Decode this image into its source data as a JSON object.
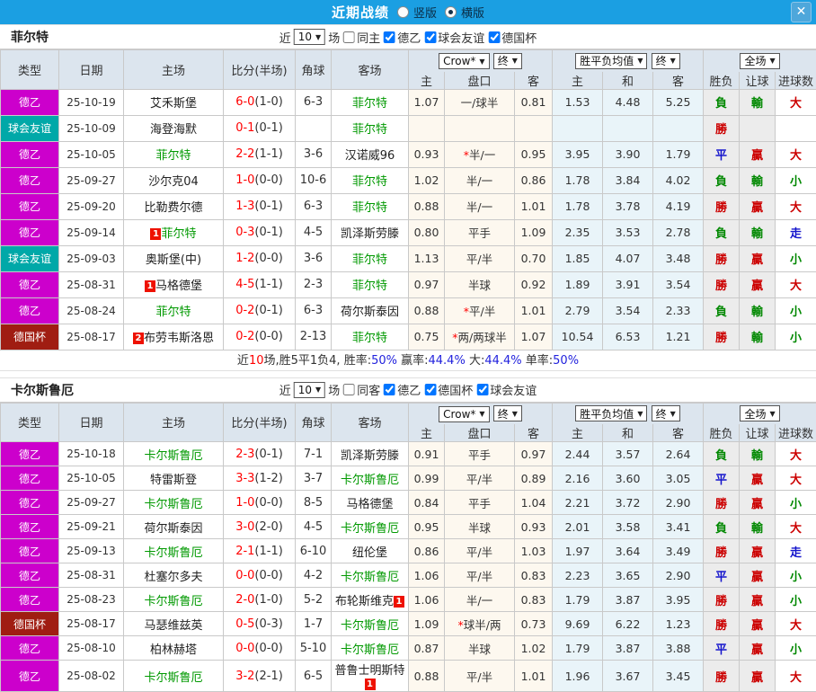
{
  "titlebar": {
    "title": "近期战绩",
    "radio_options": [
      {
        "label": "竖版",
        "selected": false
      },
      {
        "label": "横版",
        "selected": true
      }
    ],
    "close_label": "✕"
  },
  "colors": {
    "titlebar_blue": "#1b9fe2",
    "header_bg": "#dce5ee",
    "odds_bg": "#fdf8ef",
    "avg_bg": "#e9f4f9",
    "result_bg": "#ececec",
    "score_red": "#ff0000",
    "focus_team_green": "#009900",
    "summary_blue": "#2222dd",
    "badge_red": "#ee1100"
  },
  "type_colors": {
    "德乙": "#cc00cc",
    "球会友谊": "#00a8a8",
    "德国杯": "#a01d12"
  },
  "result_colors": {
    "勝": "#cc0000",
    "負": "#008800",
    "平": "#1414cc",
    "贏": "#cc0000",
    "輸": "#008800",
    "大": "#cc0000",
    "小": "#008800",
    "走": "#1414cc"
  },
  "table_labels": {
    "type": "类型",
    "date": "日期",
    "home": "主场",
    "score": "比分(半场)",
    "corner": "角球",
    "away": "客场",
    "odds_home": "主",
    "handicap": "盘口",
    "odds_away": "客",
    "avg_home": "主",
    "avg_draw": "和",
    "avg_away": "客",
    "wdl": "胜负",
    "let_result": "让球",
    "goals": "进球数",
    "dd_crown": "Crow*",
    "dd_final": "终",
    "dd_avg": "胜平负均值",
    "dd_fullmatch": "全场"
  },
  "sections": [
    {
      "team": "菲尔特",
      "filter": {
        "near_label": "近",
        "count": "10",
        "games_label": "场",
        "same_label": "同主",
        "same_checked": false,
        "comps": [
          {
            "label": "德乙",
            "checked": true
          },
          {
            "label": "球会友谊",
            "checked": true
          },
          {
            "label": "德国杯",
            "checked": true
          }
        ]
      },
      "rows": [
        {
          "type": "德乙",
          "date": "25-10-19",
          "home": "艾禾斯堡",
          "home_focus": false,
          "home_badge": "",
          "score_ft": "6-0",
          "score_ht": "(1-0)",
          "corner": "6-3",
          "away": "菲尔特",
          "away_focus": true,
          "away_badge": "",
          "odds_home": "1.07",
          "handicap": "一/球半",
          "handicap_star": false,
          "odds_away": "0.81",
          "avg_home": "1.53",
          "avg_draw": "4.48",
          "avg_away": "5.25",
          "wdl": "負",
          "let": "輸",
          "goal": "大"
        },
        {
          "type": "球会友谊",
          "date": "25-10-09",
          "home": "海登海默",
          "home_focus": false,
          "home_badge": "",
          "score_ft": "0-1",
          "score_ht": "(0-1)",
          "corner": "",
          "away": "菲尔特",
          "away_focus": true,
          "away_badge": "",
          "odds_home": "",
          "handicap": "",
          "handicap_star": false,
          "odds_away": "",
          "avg_home": "",
          "avg_draw": "",
          "avg_away": "",
          "wdl": "勝",
          "let": "",
          "goal": ""
        },
        {
          "type": "德乙",
          "date": "25-10-05",
          "home": "菲尔特",
          "home_focus": true,
          "home_badge": "",
          "score_ft": "2-2",
          "score_ht": "(1-1)",
          "corner": "3-6",
          "away": "汉诺威96",
          "away_focus": false,
          "away_badge": "",
          "odds_home": "0.93",
          "handicap": "半/一",
          "handicap_star": true,
          "odds_away": "0.95",
          "avg_home": "3.95",
          "avg_draw": "3.90",
          "avg_away": "1.79",
          "wdl": "平",
          "let": "贏",
          "goal": "大"
        },
        {
          "type": "德乙",
          "date": "25-09-27",
          "home": "沙尔克04",
          "home_focus": false,
          "home_badge": "",
          "score_ft": "1-0",
          "score_ht": "(0-0)",
          "corner": "10-6",
          "away": "菲尔特",
          "away_focus": true,
          "away_badge": "",
          "odds_home": "1.02",
          "handicap": "半/一",
          "handicap_star": false,
          "odds_away": "0.86",
          "avg_home": "1.78",
          "avg_draw": "3.84",
          "avg_away": "4.02",
          "wdl": "負",
          "let": "輸",
          "goal": "小"
        },
        {
          "type": "德乙",
          "date": "25-09-20",
          "home": "比勒费尔德",
          "home_focus": false,
          "home_badge": "",
          "score_ft": "1-3",
          "score_ht": "(0-1)",
          "corner": "6-3",
          "away": "菲尔特",
          "away_focus": true,
          "away_badge": "",
          "odds_home": "0.88",
          "handicap": "半/一",
          "handicap_star": false,
          "odds_away": "1.01",
          "avg_home": "1.78",
          "avg_draw": "3.78",
          "avg_away": "4.19",
          "wdl": "勝",
          "let": "贏",
          "goal": "大"
        },
        {
          "type": "德乙",
          "date": "25-09-14",
          "home": "菲尔特",
          "home_focus": true,
          "home_badge": "1",
          "score_ft": "0-3",
          "score_ht": "(0-1)",
          "corner": "4-5",
          "away": "凯泽斯劳滕",
          "away_focus": false,
          "away_badge": "",
          "odds_home": "0.80",
          "handicap": "平手",
          "handicap_star": false,
          "odds_away": "1.09",
          "avg_home": "2.35",
          "avg_draw": "3.53",
          "avg_away": "2.78",
          "wdl": "負",
          "let": "輸",
          "goal": "走"
        },
        {
          "type": "球会友谊",
          "date": "25-09-03",
          "home": "奥斯堡(中)",
          "home_focus": false,
          "home_badge": "",
          "score_ft": "1-2",
          "score_ht": "(0-0)",
          "corner": "3-6",
          "away": "菲尔特",
          "away_focus": true,
          "away_badge": "",
          "odds_home": "1.13",
          "handicap": "平/半",
          "handicap_star": false,
          "odds_away": "0.70",
          "avg_home": "1.85",
          "avg_draw": "4.07",
          "avg_away": "3.48",
          "wdl": "勝",
          "let": "贏",
          "goal": "小"
        },
        {
          "type": "德乙",
          "date": "25-08-31",
          "home": "马格德堡",
          "home_focus": false,
          "home_badge": "1",
          "score_ft": "4-5",
          "score_ht": "(1-1)",
          "corner": "2-3",
          "away": "菲尔特",
          "away_focus": true,
          "away_badge": "",
          "odds_home": "0.97",
          "handicap": "半球",
          "handicap_star": false,
          "odds_away": "0.92",
          "avg_home": "1.89",
          "avg_draw": "3.91",
          "avg_away": "3.54",
          "wdl": "勝",
          "let": "贏",
          "goal": "大"
        },
        {
          "type": "德乙",
          "date": "25-08-24",
          "home": "菲尔特",
          "home_focus": true,
          "home_badge": "",
          "score_ft": "0-2",
          "score_ht": "(0-1)",
          "corner": "6-3",
          "away": "荷尔斯泰因",
          "away_focus": false,
          "away_badge": "",
          "odds_home": "0.88",
          "handicap": "平/半",
          "handicap_star": true,
          "odds_away": "1.01",
          "avg_home": "2.79",
          "avg_draw": "3.54",
          "avg_away": "2.33",
          "wdl": "負",
          "let": "輸",
          "goal": "小"
        },
        {
          "type": "德国杯",
          "date": "25-08-17",
          "home": "布劳韦斯洛恩",
          "home_focus": false,
          "home_badge": "2",
          "score_ft": "0-2",
          "score_ht": "(0-0)",
          "corner": "2-13",
          "away": "菲尔特",
          "away_focus": true,
          "away_badge": "",
          "odds_home": "0.75",
          "handicap": "两/两球半",
          "handicap_star": true,
          "odds_away": "1.07",
          "avg_home": "10.54",
          "avg_draw": "6.53",
          "avg_away": "1.21",
          "wdl": "勝",
          "let": "輸",
          "goal": "小"
        }
      ],
      "summary": [
        {
          "text": "近",
          "color": "#333333"
        },
        {
          "text": "10",
          "color": "#ff0000"
        },
        {
          "text": "场,胜5平1负4, 胜率:",
          "color": "#333333"
        },
        {
          "text": "50%",
          "color": "#2222dd"
        },
        {
          "text": " 赢率:",
          "color": "#333333"
        },
        {
          "text": "44.4%",
          "color": "#2222dd"
        },
        {
          "text": " 大:",
          "color": "#333333"
        },
        {
          "text": "44.4%",
          "color": "#2222dd"
        },
        {
          "text": " 单率:",
          "color": "#333333"
        },
        {
          "text": "50%",
          "color": "#2222dd"
        }
      ]
    },
    {
      "team": "卡尔斯鲁厄",
      "filter": {
        "near_label": "近",
        "count": "10",
        "games_label": "场",
        "same_label": "同客",
        "same_checked": false,
        "comps": [
          {
            "label": "德乙",
            "checked": true
          },
          {
            "label": "德国杯",
            "checked": true
          },
          {
            "label": "球会友谊",
            "checked": true
          }
        ]
      },
      "rows": [
        {
          "type": "德乙",
          "date": "25-10-18",
          "home": "卡尔斯鲁厄",
          "home_focus": true,
          "home_badge": "",
          "score_ft": "2-3",
          "score_ht": "(0-1)",
          "corner": "7-1",
          "away": "凯泽斯劳滕",
          "away_focus": false,
          "away_badge": "",
          "odds_home": "0.91",
          "handicap": "平手",
          "handicap_star": false,
          "odds_away": "0.97",
          "avg_home": "2.44",
          "avg_draw": "3.57",
          "avg_away": "2.64",
          "wdl": "負",
          "let": "輸",
          "goal": "大"
        },
        {
          "type": "德乙",
          "date": "25-10-05",
          "home": "特雷斯登",
          "home_focus": false,
          "home_badge": "",
          "score_ft": "3-3",
          "score_ht": "(1-2)",
          "corner": "3-7",
          "away": "卡尔斯鲁厄",
          "away_focus": true,
          "away_badge": "",
          "odds_home": "0.99",
          "handicap": "平/半",
          "handicap_star": false,
          "odds_away": "0.89",
          "avg_home": "2.16",
          "avg_draw": "3.60",
          "avg_away": "3.05",
          "wdl": "平",
          "let": "贏",
          "goal": "大"
        },
        {
          "type": "德乙",
          "date": "25-09-27",
          "home": "卡尔斯鲁厄",
          "home_focus": true,
          "home_badge": "",
          "score_ft": "1-0",
          "score_ht": "(0-0)",
          "corner": "8-5",
          "away": "马格德堡",
          "away_focus": false,
          "away_badge": "",
          "odds_home": "0.84",
          "handicap": "平手",
          "handicap_star": false,
          "odds_away": "1.04",
          "avg_home": "2.21",
          "avg_draw": "3.72",
          "avg_away": "2.90",
          "wdl": "勝",
          "let": "贏",
          "goal": "小"
        },
        {
          "type": "德乙",
          "date": "25-09-21",
          "home": "荷尔斯泰因",
          "home_focus": false,
          "home_badge": "",
          "score_ft": "3-0",
          "score_ht": "(2-0)",
          "corner": "4-5",
          "away": "卡尔斯鲁厄",
          "away_focus": true,
          "away_badge": "",
          "odds_home": "0.95",
          "handicap": "半球",
          "handicap_star": false,
          "odds_away": "0.93",
          "avg_home": "2.01",
          "avg_draw": "3.58",
          "avg_away": "3.41",
          "wdl": "負",
          "let": "輸",
          "goal": "大"
        },
        {
          "type": "德乙",
          "date": "25-09-13",
          "home": "卡尔斯鲁厄",
          "home_focus": true,
          "home_badge": "",
          "score_ft": "2-1",
          "score_ht": "(1-1)",
          "corner": "6-10",
          "away": "纽伦堡",
          "away_focus": false,
          "away_badge": "",
          "odds_home": "0.86",
          "handicap": "平/半",
          "handicap_star": false,
          "odds_away": "1.03",
          "avg_home": "1.97",
          "avg_draw": "3.64",
          "avg_away": "3.49",
          "wdl": "勝",
          "let": "贏",
          "goal": "走"
        },
        {
          "type": "德乙",
          "date": "25-08-31",
          "home": "杜塞尔多夫",
          "home_focus": false,
          "home_badge": "",
          "score_ft": "0-0",
          "score_ht": "(0-0)",
          "corner": "4-2",
          "away": "卡尔斯鲁厄",
          "away_focus": true,
          "away_badge": "",
          "odds_home": "1.06",
          "handicap": "平/半",
          "handicap_star": false,
          "odds_away": "0.83",
          "avg_home": "2.23",
          "avg_draw": "3.65",
          "avg_away": "2.90",
          "wdl": "平",
          "let": "贏",
          "goal": "小"
        },
        {
          "type": "德乙",
          "date": "25-08-23",
          "home": "卡尔斯鲁厄",
          "home_focus": true,
          "home_badge": "",
          "score_ft": "2-0",
          "score_ht": "(1-0)",
          "corner": "5-2",
          "away": "布轮斯维克",
          "away_focus": false,
          "away_badge": "1",
          "odds_home": "1.06",
          "handicap": "半/一",
          "handicap_star": false,
          "odds_away": "0.83",
          "avg_home": "1.79",
          "avg_draw": "3.87",
          "avg_away": "3.95",
          "wdl": "勝",
          "let": "贏",
          "goal": "小"
        },
        {
          "type": "德国杯",
          "date": "25-08-17",
          "home": "马瑟维兹英",
          "home_focus": false,
          "home_badge": "",
          "score_ft": "0-5",
          "score_ht": "(0-3)",
          "corner": "1-7",
          "away": "卡尔斯鲁厄",
          "away_focus": true,
          "away_badge": "",
          "odds_home": "1.09",
          "handicap": "球半/两",
          "handicap_star": true,
          "odds_away": "0.73",
          "avg_home": "9.69",
          "avg_draw": "6.22",
          "avg_away": "1.23",
          "wdl": "勝",
          "let": "贏",
          "goal": "大"
        },
        {
          "type": "德乙",
          "date": "25-08-10",
          "home": "柏林赫塔",
          "home_focus": false,
          "home_badge": "",
          "score_ft": "0-0",
          "score_ht": "(0-0)",
          "corner": "5-10",
          "away": "卡尔斯鲁厄",
          "away_focus": true,
          "away_badge": "",
          "odds_home": "0.87",
          "handicap": "半球",
          "handicap_star": false,
          "odds_away": "1.02",
          "avg_home": "1.79",
          "avg_draw": "3.87",
          "avg_away": "3.88",
          "wdl": "平",
          "let": "贏",
          "goal": "小"
        },
        {
          "type": "德乙",
          "date": "25-08-02",
          "home": "卡尔斯鲁厄",
          "home_focus": true,
          "home_badge": "",
          "score_ft": "3-2",
          "score_ht": "(2-1)",
          "corner": "6-5",
          "away": "普鲁士明斯特",
          "away_focus": false,
          "away_badge": "1",
          "odds_home": "0.88",
          "handicap": "平/半",
          "handicap_star": false,
          "odds_away": "1.01",
          "avg_home": "1.96",
          "avg_draw": "3.67",
          "avg_away": "3.45",
          "wdl": "勝",
          "let": "贏",
          "goal": "大"
        }
      ],
      "summary": []
    }
  ]
}
